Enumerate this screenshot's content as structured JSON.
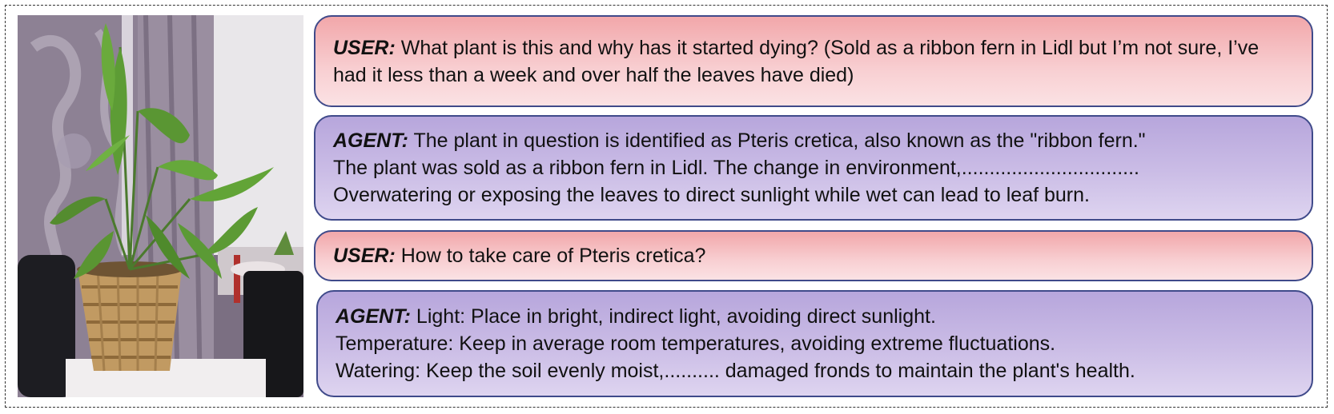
{
  "conversation": [
    {
      "role_label": "USER:",
      "text": " What plant is this and why has it started dying? (Sold as a ribbon fern in Lidl but I’m not sure, I’ve had it less than a week and over half the leaves have died)"
    },
    {
      "role_label": "AGENT:",
      "lines": [
        " The plant in question is identified as Pteris cretica, also known as the \"ribbon fern.\"",
        "The plant was sold as a ribbon fern in Lidl. The change in environment,................................",
        "Overwatering or exposing the leaves to direct sunlight while wet can lead to leaf burn."
      ]
    },
    {
      "role_label": "USER:",
      "text": " How to take care of Pteris cretica?"
    },
    {
      "role_label": "AGENT:",
      "lines": [
        " Light: Place in bright, indirect light, avoiding direct sunlight.",
        "Temperature: Keep in average room temperatures, avoiding extreme fluctuations.",
        "Watering: Keep the soil evenly moist,.......... damaged fronds to maintain the plant's health."
      ]
    }
  ],
  "colors": {
    "user_bubble": "#f4b9bc",
    "agent_bubble": "#c9bce6",
    "bubble_border": "#3f4a8a"
  }
}
